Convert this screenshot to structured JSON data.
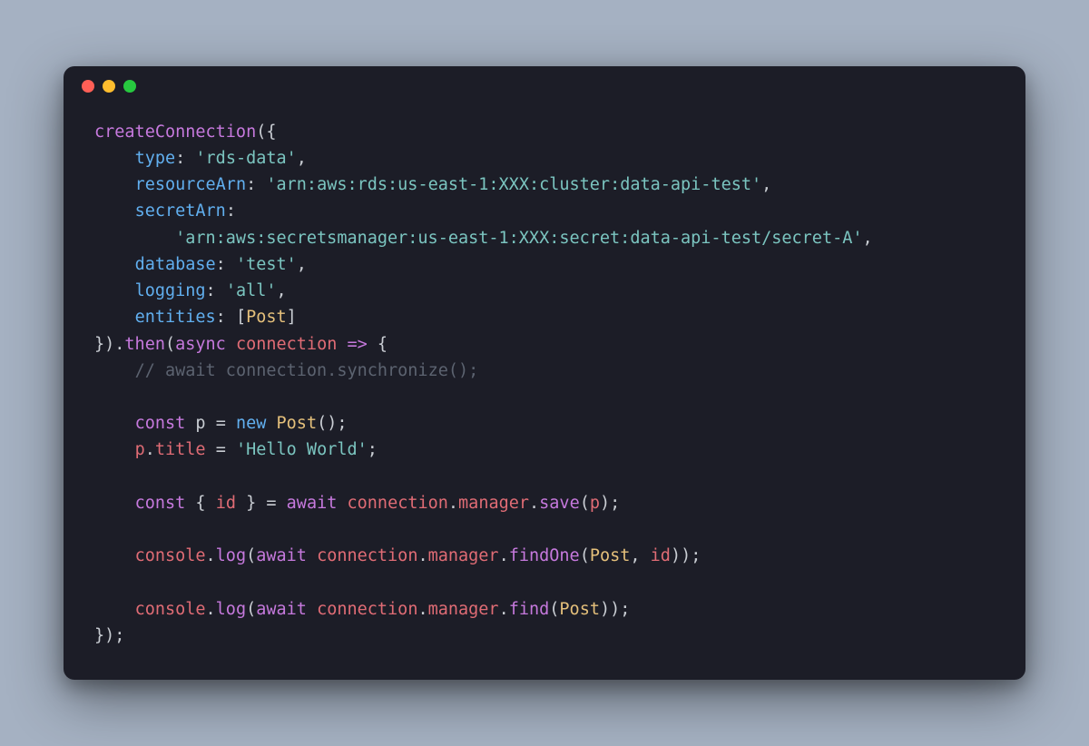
{
  "window": {
    "traffic_lights": [
      "red",
      "yellow",
      "green"
    ]
  },
  "code": {
    "fn_createConnection": "createConnection",
    "paren_open": "(",
    "brace_open": "{",
    "key_type": "type",
    "colon": ":",
    "val_type": "'rds-data'",
    "comma": ",",
    "key_resourceArn": "resourceArn",
    "val_resourceArn": "'arn:aws:rds:us-east-1:XXX:cluster:data-api-test'",
    "key_secretArn": "secretArn",
    "val_secretArn": "'arn:aws:secretsmanager:us-east-1:XXX:secret:data-api-test/secret-A'",
    "key_database": "database",
    "val_database": "'test'",
    "key_logging": "logging",
    "val_logging": "'all'",
    "key_entities": "entities",
    "bracket_open": "[",
    "entity_Post": "Post",
    "bracket_close": "]",
    "brace_close": "}",
    "paren_close": ")",
    "dot": ".",
    "fn_then": "then",
    "kw_async": "async",
    "param_connection": "connection",
    "arrow": "=>",
    "comment_sync": "// await connection.synchronize();",
    "kw_const": "const",
    "var_p": "p",
    "eq": "=",
    "kw_new": "new",
    "cls_Post": "Post",
    "empty_parens": "()",
    "semi": ";",
    "prop_title": "title",
    "val_title": "'Hello World'",
    "destruct_open": "{ ",
    "var_id": "id",
    "destruct_close": " }",
    "kw_await": "await",
    "obj_connection": "connection",
    "prop_manager": "manager",
    "fn_save": "save",
    "arg_p": "p",
    "obj_console": "console",
    "fn_log": "log",
    "fn_findOne": "findOne",
    "arg_Post": "Post",
    "arg_id": "id",
    "fn_find": "find",
    "final": "});"
  }
}
